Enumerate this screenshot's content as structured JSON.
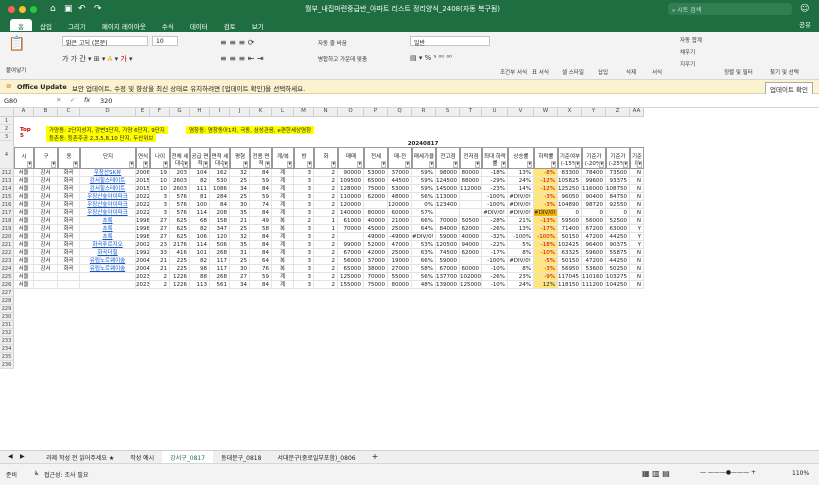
{
  "titlebar": {
    "title": "월부_내집마련중급반_아파트 리스트 정리양식_2408(자동 복구됨)",
    "search_placeholder": "시트 검색",
    "share": "공유"
  },
  "tabs": [
    "홈",
    "삽입",
    "그리기",
    "페이지 레이아웃",
    "수식",
    "데이터",
    "검토",
    "보기"
  ],
  "ribbon": {
    "paste": "붙여넣기",
    "font": "맑은 고딕 (본문)",
    "size": "10",
    "wrap": "자동 줄 바꿈",
    "merge": "병합하고 가운데 맞춤",
    "format": "일반",
    "cond": "조건부 서식",
    "table": "표 서식",
    "cellstyle": "셀 스타일",
    "insert": "삽입",
    "delete": "삭제",
    "fmt": "서식",
    "autosum": "자동 합계",
    "fill": "채우기",
    "clear": "지우기",
    "sortfilter": "정렬 및 필터",
    "findselect": "찾기 및 선택"
  },
  "update": {
    "title": "Office Update",
    "message": "보안 업데이트, 수정 및 향상을 최신 상태로 유지하려면 [업데이트 확인]을 선택하세요.",
    "button": "업데이트 확인"
  },
  "formula": {
    "cellref": "G80",
    "value": "320"
  },
  "columns": [
    "A",
    "B",
    "C",
    "D",
    "E",
    "F",
    "G",
    "H",
    "I",
    "J",
    "K",
    "L",
    "M",
    "N",
    "O",
    "P",
    "Q",
    "R",
    "S",
    "T",
    "U",
    "V",
    "W",
    "X",
    "Y",
    "Z",
    "AA"
  ],
  "top": {
    "label": "Top 5",
    "line1": "가양동: 2단지성지, 강변3단지, 가양 6단지, 9단지",
    "line2": "등촌동: 등촌주공 2,3,5,8,10 단지, 두산위브",
    "line3": "염창동: 염창동아1차, 극동, 삼성관음, e편한세상염창"
  },
  "date_header": "20240817",
  "headers": [
    "시",
    "구",
    "동",
    "단지",
    "연식",
    "나이",
    "전체 세대수",
    "공급 면적",
    "면적 세대수",
    "평형",
    "전용 면적",
    "계/복",
    "방",
    "화",
    "매매",
    "전세",
    "매-전",
    "매세가율",
    "전고점",
    "전저점",
    "최대 하락률",
    "상승률",
    "하락률",
    "기준여부 (-15%)",
    "기준가 (-20%)",
    "기준가 (-25%)",
    "기준여 (-15%"
  ],
  "rows": [
    {
      "n": "212",
      "c": [
        "서울",
        "강서",
        "화곡",
        "우장산SK뷰",
        "2006",
        "19",
        "203",
        "104",
        "162",
        "32",
        "84",
        "계",
        "3",
        "2",
        "90000",
        "53000",
        "37000",
        "59%",
        "98000",
        "80000",
        "-18%",
        "13%",
        "-8%",
        "83300",
        "78400",
        "73500",
        "N"
      ]
    },
    {
      "n": "213",
      "c": [
        "서울",
        "강서",
        "화곡",
        "강서힐스테이트",
        "2015",
        "10",
        "2603",
        "82",
        "530",
        "25",
        "59",
        "계",
        "3",
        "2",
        "109500",
        "65000",
        "44500",
        "59%",
        "124500",
        "88000",
        "-29%",
        "24%",
        "-12%",
        "105825",
        "99600",
        "93375",
        "N"
      ]
    },
    {
      "n": "214",
      "c": [
        "서울",
        "강서",
        "화곡",
        "강서힐스테이트",
        "2015",
        "10",
        "2603",
        "111",
        "1086",
        "34",
        "84",
        "계",
        "3",
        "2",
        "128000",
        "75000",
        "53000",
        "59%",
        "145000",
        "112000",
        "-23%",
        "14%",
        "-12%",
        "125250",
        "116000",
        "108750",
        "N"
      ]
    },
    {
      "n": "215",
      "c": [
        "서울",
        "강서",
        "화곡",
        "우장산숲아이파크",
        "2022",
        "3",
        "576",
        "81",
        "284",
        "25",
        "59",
        "계",
        "3",
        "2",
        "110000",
        "62000",
        "48000",
        "56%",
        "113000",
        "",
        "-100%",
        "#DIV/0!",
        "-3%",
        "96050",
        "90400",
        "84750",
        "N"
      ]
    },
    {
      "n": "216",
      "c": [
        "서울",
        "강서",
        "화곡",
        "우장산숲아이파크",
        "2022",
        "3",
        "576",
        "100",
        "84",
        "30",
        "74",
        "계",
        "3",
        "2",
        "120000",
        "",
        "120000",
        "0%",
        "123400",
        "",
        "-100%",
        "#DIV/0!",
        "-3%",
        "104890",
        "98720",
        "92550",
        "N"
      ]
    },
    {
      "n": "217",
      "c": [
        "서울",
        "강서",
        "화곡",
        "우장산숲아이파크",
        "2022",
        "3",
        "576",
        "114",
        "208",
        "35",
        "84",
        "계",
        "3",
        "2",
        "140000",
        "80000",
        "60000",
        "57%",
        "",
        "",
        "#DIV/0!",
        "#DIV/0!",
        "#DIV/0!",
        "0",
        "0",
        "0",
        "N"
      ]
    },
    {
      "n": "218",
      "c": [
        "서울",
        "강서",
        "화곡",
        "초록",
        "1998",
        "27",
        "625",
        "68",
        "158",
        "21",
        "49",
        "복",
        "2",
        "1",
        "61000",
        "40000",
        "21000",
        "66%",
        "70000",
        "50500",
        "-28%",
        "21%",
        "-13%",
        "59500",
        "56000",
        "52500",
        "N"
      ]
    },
    {
      "n": "219",
      "c": [
        "서울",
        "강서",
        "화곡",
        "초록",
        "1998",
        "27",
        "625",
        "82",
        "347",
        "25",
        "58",
        "복",
        "3",
        "1",
        "70000",
        "45000",
        "25000",
        "64%",
        "84000",
        "62000",
        "-26%",
        "13%",
        "-17%",
        "71400",
        "67200",
        "63000",
        "Y"
      ]
    },
    {
      "n": "220",
      "c": [
        "서울",
        "강서",
        "화곡",
        "초록",
        "1998",
        "27",
        "625",
        "106",
        "120",
        "32",
        "84",
        "계",
        "3",
        "2",
        "",
        "49000",
        "-49000",
        "#DIV/0!",
        "59000",
        "40000",
        "-32%",
        "-100%",
        "-100%",
        "50150",
        "47200",
        "44250",
        "Y"
      ]
    },
    {
      "n": "221",
      "c": [
        "서울",
        "강서",
        "화곡",
        "화곡푸르지오",
        "2002",
        "23",
        "2176",
        "114",
        "506",
        "35",
        "84",
        "계",
        "3",
        "2",
        "99000",
        "52000",
        "47000",
        "53%",
        "120500",
        "94000",
        "-22%",
        "5%",
        "-18%",
        "102425",
        "96400",
        "90375",
        "Y"
      ]
    },
    {
      "n": "222",
      "c": [
        "서울",
        "강서",
        "화곡",
        "화곡더힐",
        "1992",
        "33",
        "416",
        "101",
        "268",
        "31",
        "84",
        "계",
        "3",
        "2",
        "67000",
        "42000",
        "25000",
        "63%",
        "74500",
        "62000",
        "-17%",
        "8%",
        "-10%",
        "63325",
        "59600",
        "55875",
        "N"
      ]
    },
    {
      "n": "223",
      "c": [
        "서울",
        "강서",
        "화곡",
        "유림노르웨이숲",
        "2004",
        "21",
        "225",
        "82",
        "117",
        "25",
        "64",
        "복",
        "3",
        "2",
        "56000",
        "37000",
        "19000",
        "66%",
        "59000",
        "",
        "-100%",
        "#DIV/0!",
        "-5%",
        "50150",
        "47200",
        "44250",
        "N"
      ]
    },
    {
      "n": "224",
      "c": [
        "서울",
        "강서",
        "화곡",
        "유림노르웨이숲",
        "2004",
        "21",
        "225",
        "98",
        "117",
        "30",
        "76",
        "복",
        "3",
        "2",
        "65000",
        "38000",
        "27000",
        "58%",
        "67000",
        "60000",
        "-10%",
        "8%",
        "-3%",
        "56950",
        "53600",
        "50250",
        "N"
      ]
    },
    {
      "n": "225",
      "c": [
        "서울",
        "",
        "",
        "",
        "2023",
        "2",
        "1226",
        "88",
        "268",
        "27",
        "59",
        "계",
        "3",
        "2",
        "125000",
        "70000",
        "55000",
        "56%",
        "137700",
        "102000",
        "-26%",
        "23%",
        "-9%",
        "117045",
        "110160",
        "103275",
        "N"
      ]
    },
    {
      "n": "226",
      "c": [
        "서울",
        "",
        "",
        "",
        "2023",
        "2",
        "1226",
        "113",
        "561",
        "34",
        "84",
        "계",
        "3",
        "2",
        "155000",
        "75000",
        "80000",
        "48%",
        "139000",
        "125000",
        "-10%",
        "24%",
        "12%",
        "118150",
        "111200",
        "104250",
        "N"
      ]
    }
  ],
  "empty_rows": [
    "227",
    "228",
    "229",
    "230",
    "231",
    "232",
    "233",
    "234",
    "235",
    "236"
  ],
  "sheets": [
    "과제 작성 전 읽어주세요 ★",
    "작성 예시",
    "강서구_0817",
    "동대문구_0818",
    "서대문구(중로일부포함)_0806"
  ],
  "active_sheet": "강서구_0817",
  "status": {
    "ready": "준비",
    "access": "접근성: 조사 필요",
    "zoom": "110%"
  }
}
